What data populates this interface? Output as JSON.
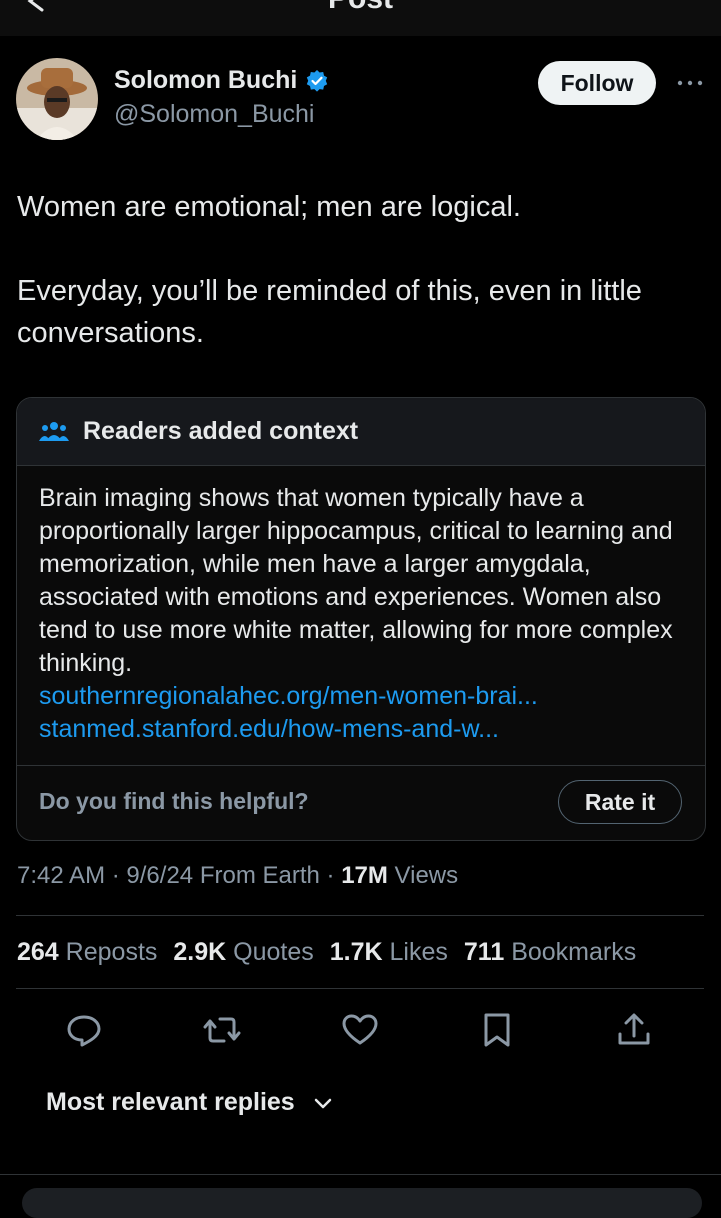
{
  "topbar": {
    "title": "Post"
  },
  "author": {
    "name": "Solomon Buchi",
    "handle": "@Solomon_Buchi",
    "follow_label": "Follow"
  },
  "tweet": {
    "line1": "Women are emotional; men are logical.",
    "line2": "Everyday, you’ll be reminded of this, even in little conversations."
  },
  "note": {
    "header": "Readers added context",
    "body": "Brain imaging shows that women typically have a proportionally larger hippocampus, critical to learning and memorization, while men have a larger amygdala, associated with emotions and experiences. Women also tend to use more white matter, allowing for more complex thinking.",
    "links": [
      "southernregionalahec.org/men-women-brai...",
      "stanmed.stanford.edu/how-mens-and-w..."
    ],
    "helpful_prompt": "Do you find this helpful?",
    "rate_label": "Rate it"
  },
  "meta": {
    "time": "7:42 AM",
    "date": "9/6/24",
    "source": "From Earth",
    "views_count": "17M",
    "views_label": "Views"
  },
  "stats": [
    {
      "count": "264",
      "label": "Reposts"
    },
    {
      "count": "2.9K",
      "label": "Quotes"
    },
    {
      "count": "1.7K",
      "label": "Likes"
    },
    {
      "count": "711",
      "label": "Bookmarks"
    }
  ],
  "actions": [
    "reply-icon",
    "repost-icon",
    "like-icon",
    "bookmark-icon",
    "share-icon"
  ],
  "replies": {
    "sort_label": "Most relevant replies"
  },
  "colors": {
    "accent": "#1d9bf0",
    "background": "#000000",
    "muted": "#8b98a5"
  }
}
